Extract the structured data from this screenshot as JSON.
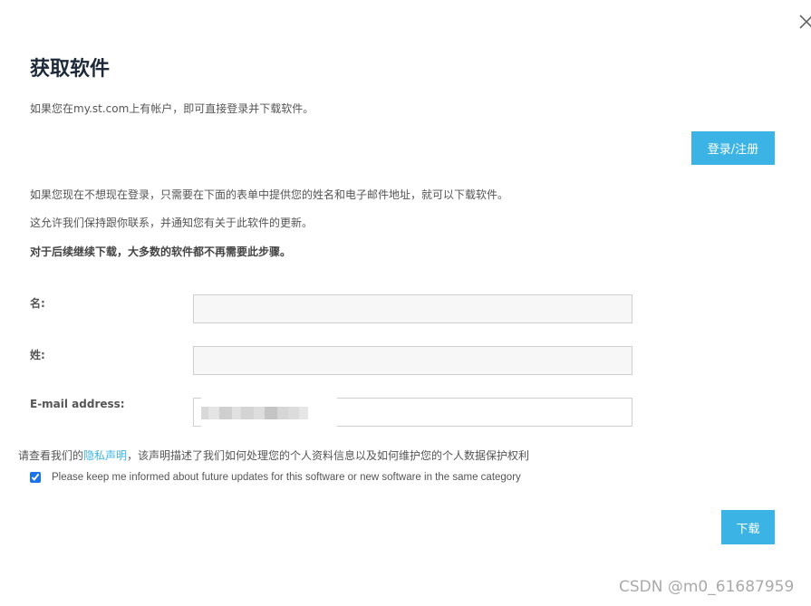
{
  "dialog": {
    "title": "获取软件",
    "intro": "如果您在my.st.com上有帐户，即可直接登录并下载软件。",
    "login_button": "登录/注册",
    "line1": "如果您现在不想现在登录，只需要在下面的表单中提供您的姓名和电子邮件地址，就可以下载软件。",
    "line2": "这允许我们保持跟你联系，并通知您有关于此软件的更新。",
    "line3": "对于后续继续下载，大多数的软件都不再需要此步骤。"
  },
  "form": {
    "first_name_label": "名:",
    "last_name_label": "姓:",
    "email_label": "E-mail address:",
    "first_name_value": "",
    "last_name_value": "",
    "email_value": ""
  },
  "privacy": {
    "prefix": "请查看我们的",
    "link": "隐私声明",
    "suffix": "，该声明描述了我们如何处理您的个人资料信息以及如何维护您的个人数据保护权利"
  },
  "consent": {
    "checked": true,
    "label": "Please keep me informed about future updates for this software or new software in the same category"
  },
  "download_button": "下载",
  "watermark": "CSDN @m0_61687959",
  "colors": {
    "accent": "#3bb4e5",
    "title": "#1d2a3a"
  },
  "icons": {
    "close": "close-icon"
  }
}
